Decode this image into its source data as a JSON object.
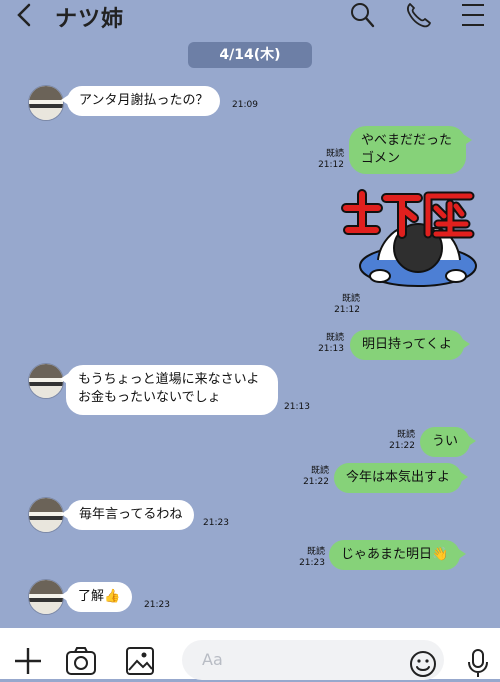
{
  "header": {
    "back_icon": "chevron-left-icon",
    "title": "ナツ姉",
    "icons": [
      "search-icon",
      "phone-icon",
      "menu-icon"
    ]
  },
  "date_label": "4/14(木)",
  "messages": [
    {
      "side": "in",
      "text": "アンタ月謝払ったの？",
      "time": "21:09"
    },
    {
      "side": "out",
      "lines": [
        "やべまだだった",
        "ゴメン"
      ],
      "read": "既読",
      "time": "21:12"
    },
    {
      "side": "out",
      "type": "sticker",
      "sticker_text": "土下座",
      "read": "既読",
      "time": "21:12"
    },
    {
      "side": "out",
      "text": "明日持ってくよ",
      "read": "既読",
      "time": "21:13"
    },
    {
      "side": "in",
      "lines": [
        "もうちょっと道場に来なさいよ",
        "お金もったいないでしょ"
      ],
      "time": "21:13"
    },
    {
      "side": "out",
      "text": "うい",
      "read": "既読",
      "time": "21:22"
    },
    {
      "side": "out",
      "text": "今年は本気出すよ",
      "read": "既読",
      "time": "21:22"
    },
    {
      "side": "in",
      "text": "毎年言ってるわね",
      "time": "21:23"
    },
    {
      "side": "out",
      "text": "じゃあまた明日👋",
      "read": "既読",
      "time": "21:23"
    },
    {
      "side": "in",
      "text": "了解👍",
      "time": "21:23"
    }
  ],
  "input": {
    "placeholder": "Aa",
    "icons": [
      "plus-icon",
      "camera-icon",
      "image-icon",
      "emoji-icon",
      "mic-icon"
    ]
  },
  "colors": {
    "background": "#97a8cd",
    "outgoing_bubble": "#86d279",
    "incoming_bubble": "#ffffff",
    "date_pill": "#6d7fa6"
  }
}
